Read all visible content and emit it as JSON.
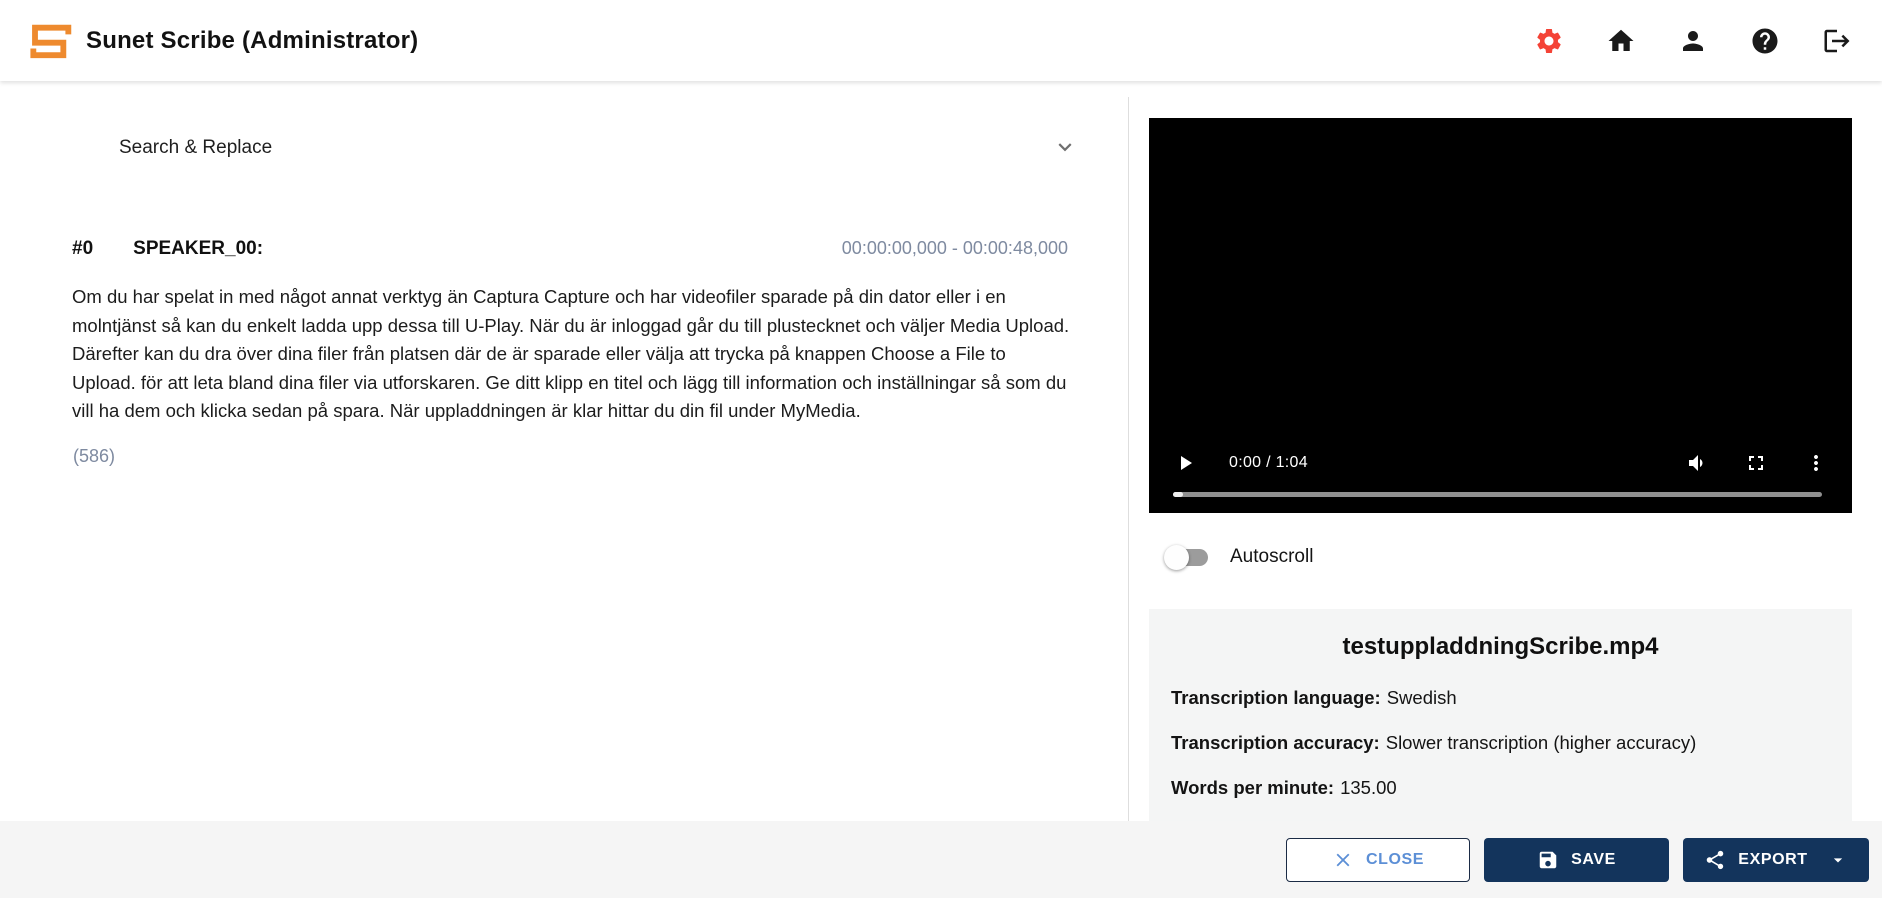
{
  "header": {
    "title": "Sunet Scribe (Administrator)",
    "icons": [
      {
        "name": "settings-icon",
        "color": "#F44336"
      },
      {
        "name": "home-icon",
        "color": "#1A1A1A"
      },
      {
        "name": "account-icon",
        "color": "#1A1A1A"
      },
      {
        "name": "help-icon",
        "color": "#1A1A1A"
      },
      {
        "name": "logout-icon",
        "color": "#1A1A1A"
      }
    ]
  },
  "search_replace": {
    "label": "Search & Replace",
    "expanded": false
  },
  "transcript": {
    "segments": [
      {
        "index": "#0",
        "speaker": "SPEAKER_00:",
        "timerange": "00:00:00,000 - 00:00:48,000",
        "text": "Om du har spelat in med något annat verktyg än Captura Capture och har videofiler sparade på din dator eller i en molntjänst så kan du enkelt ladda upp dessa till U-Play. När du är inloggad går du till plustecknet och väljer Media Upload. Därefter kan du dra över dina filer från platsen där de är sparade eller välja att trycka på knappen Choose a File to Upload. för att leta bland dina filer via utforskaren. Ge ditt klipp en titel och lägg till information och inställningar så som du vill ha dem och klicka sedan på spara. När uppladdningen är klar hittar du din fil under MyMedia.",
        "char_count": "(586)"
      }
    ]
  },
  "player": {
    "time_display": "0:00 / 1:04",
    "current_time": "0:00",
    "duration": "1:04"
  },
  "autoscroll": {
    "label": "Autoscroll",
    "enabled": false
  },
  "media_info": {
    "filename": "testuppladdningScribe.mp4",
    "rows": [
      {
        "label": "Transcription language:",
        "value": "Swedish"
      },
      {
        "label": "Transcription accuracy:",
        "value": "Slower transcription (higher accuracy)"
      },
      {
        "label": "Words per minute:",
        "value": "135.00"
      }
    ]
  },
  "footer": {
    "close_label": "CLOSE",
    "save_label": "SAVE",
    "export_label": "EXPORT"
  },
  "colors": {
    "brand_orange": "#EE8A2E",
    "settings_red": "#F44336",
    "navy": "#13345C",
    "close_blue": "#5C8FD6",
    "muted_blue_gray": "#7E8AA0"
  }
}
